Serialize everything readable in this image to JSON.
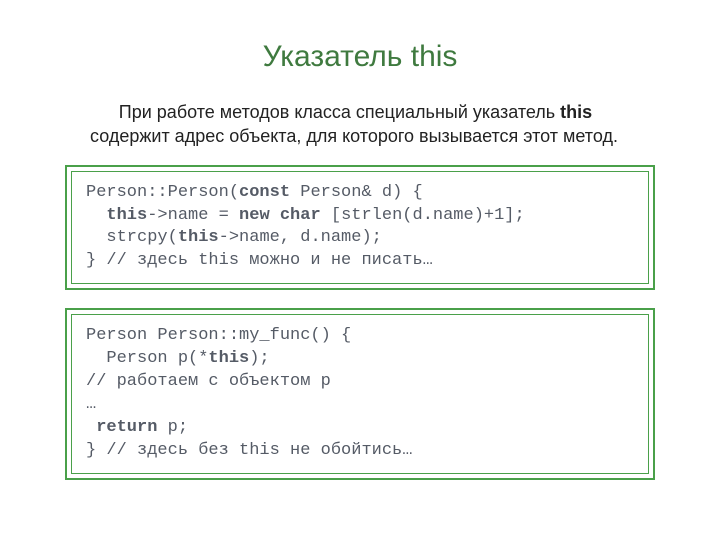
{
  "title": "Указатель this",
  "paragraph_indent": "При работе методов класса специальный указатель ",
  "paragraph_bold": "this",
  "paragraph_rest": " содержит адрес объекта, для которого вызывается этот метод.",
  "code1": {
    "l1a": "Person::Person(",
    "l1b": "const",
    "l1c": " Person& d) {",
    "l2a": "  ",
    "l2b": "this",
    "l2c": "->name = ",
    "l2d": "new char",
    "l2e": " [strlen(d.name)+1];",
    "l3a": "  strcpy(",
    "l3b": "this",
    "l3c": "->name, d.name);",
    "l4": "} // здесь this можно и не писать…"
  },
  "code2": {
    "l1": "Person Person::my_func() {",
    "l2a": "  Person p(*",
    "l2b": "this",
    "l2c": ");",
    "l3": "// работаем с объектом p",
    "l4": "…",
    "l5a": " ",
    "l5b": "return",
    "l5c": " p;",
    "l6": "} // здесь без this не обойтись…"
  }
}
